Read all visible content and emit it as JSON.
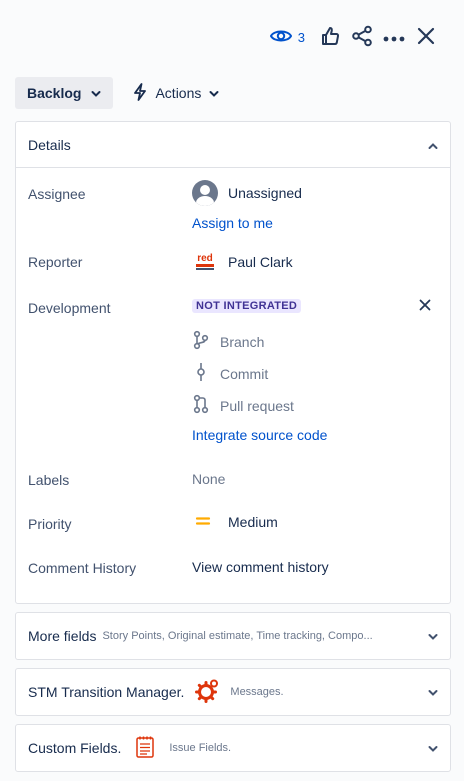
{
  "header": {
    "watch_count": "3",
    "icons": [
      "eye-icon",
      "thumbs-up-icon",
      "share-icon",
      "more-icon",
      "close-icon"
    ]
  },
  "status": {
    "label": "Backlog",
    "actions_label": "Actions"
  },
  "details": {
    "title": "Details",
    "assignee": {
      "label": "Assignee",
      "value": "Unassigned",
      "assign_link": "Assign to me"
    },
    "reporter": {
      "label": "Reporter",
      "value": "Paul Clark",
      "avatar_text": "red"
    },
    "development": {
      "label": "Development",
      "badge": "NOT INTEGRATED",
      "items": [
        "Branch",
        "Commit",
        "Pull request"
      ],
      "link": "Integrate source code"
    },
    "labels": {
      "label": "Labels",
      "value": "None"
    },
    "priority": {
      "label": "Priority",
      "value": "Medium",
      "color": "#ffab00"
    },
    "comment_history": {
      "label": "Comment History",
      "value": "View comment history"
    }
  },
  "more_fields": {
    "title": "More fields",
    "summary": "Story Points, Original estimate, Time tracking, Compo..."
  },
  "stm": {
    "title": "STM Transition Manager.",
    "subtitle": "Messages."
  },
  "custom_fields": {
    "title": "Custom Fields.",
    "subtitle": "Issue Fields."
  },
  "colors": {
    "link": "#0052cc",
    "badge_bg": "#eae6ff",
    "badge_text": "#403294"
  }
}
